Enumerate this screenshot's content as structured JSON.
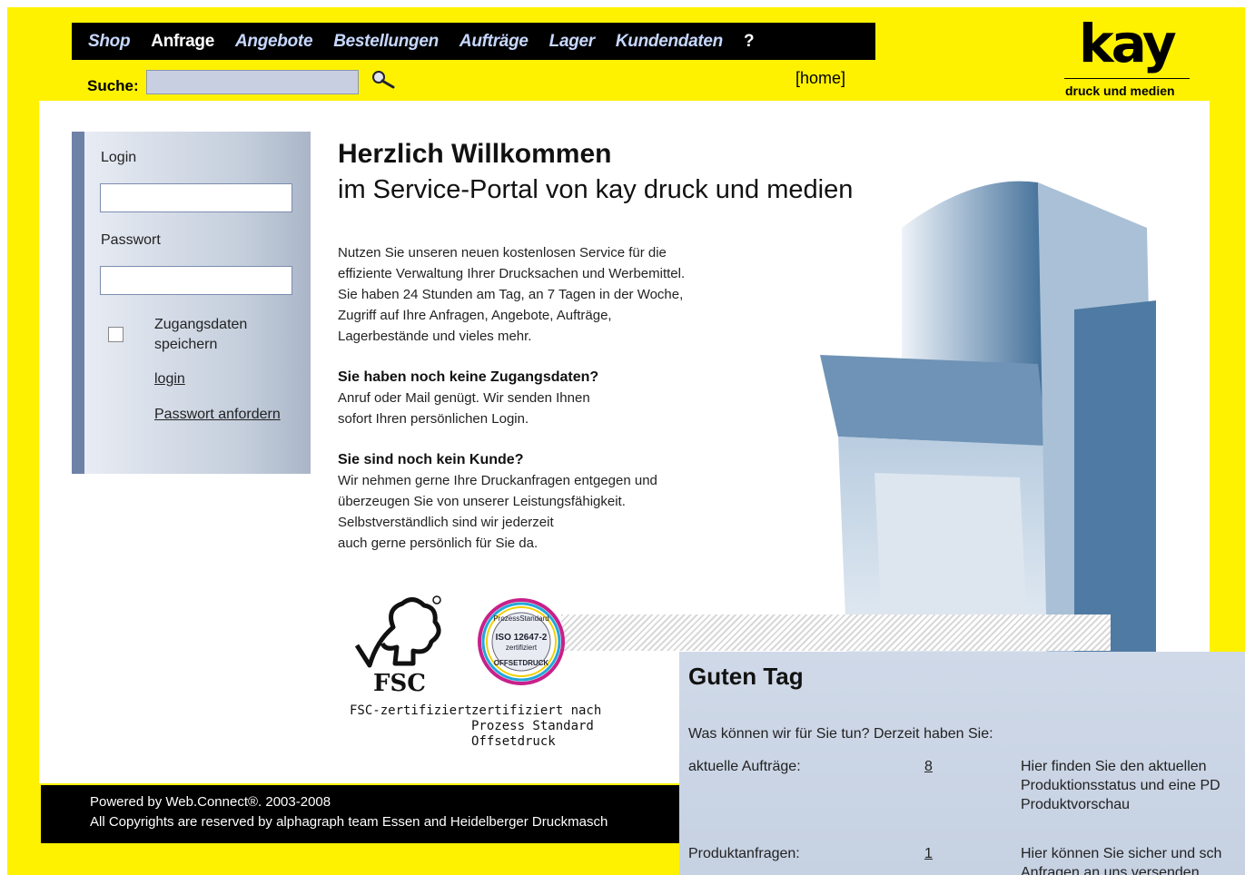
{
  "nav": {
    "items": [
      {
        "label": "Shop",
        "active": false
      },
      {
        "label": "Anfrage",
        "active": true
      },
      {
        "label": "Angebote",
        "active": false
      },
      {
        "label": "Bestellungen",
        "active": false
      },
      {
        "label": "Aufträge",
        "active": false
      },
      {
        "label": "Lager",
        "active": false
      },
      {
        "label": "Kundendaten",
        "active": false
      },
      {
        "label": "?",
        "active": false
      }
    ]
  },
  "search": {
    "label": "Suche:",
    "value": ""
  },
  "home_link": "[home]",
  "logo": {
    "name": "kay",
    "subtitle": "druck und medien"
  },
  "login": {
    "login_label": "Login",
    "login_value": "",
    "password_label": "Passwort",
    "password_value": "",
    "remember_label_1": "Zugangsdaten",
    "remember_label_2": "speichern",
    "remember_checked": false,
    "login_link": "login",
    "request_password_link": "Passwort anfordern"
  },
  "welcome": {
    "title": "Herzlich Willkommen",
    "subtitle": "im Service-Portal von kay druck und medien",
    "intro": [
      "Nutzen Sie unseren neuen kostenlosen Service für die",
      "effiziente Verwaltung Ihrer Drucksachen und Werbemittel.",
      "Sie haben 24 Stunden am Tag, an 7 Tagen in der Woche,",
      "Zugriff auf Ihre Anfragen, Angebote, Aufträge,",
      "Lagerbestände und vieles mehr."
    ],
    "no_access_heading": "Sie haben noch keine Zugangsdaten?",
    "no_access_text": [
      "Anruf oder Mail genügt. Wir senden Ihnen",
      "sofort Ihren persönlichen Login."
    ],
    "no_customer_heading": "Sie sind noch kein Kunde?",
    "no_customer_text": [
      "Wir nehmen gerne Ihre Druckanfragen entgegen und",
      "überzeugen Sie von unserer Leistungsfähigkeit.",
      "Selbstverständlich sind wir jederzeit",
      "auch gerne persönlich für Sie da."
    ]
  },
  "certs": {
    "fsc_logo_text": "FSC",
    "fsc_caption": "FSC-zertifiziert",
    "iso_badge_text": [
      "ProzessStandard",
      "ISO 12647-2",
      "zertifiziert",
      "OFFSETDRUCK"
    ],
    "iso_caption": [
      "zertifiziert nach",
      "Prozess Standard",
      "Offsetdruck"
    ]
  },
  "footer": {
    "line1": "Powered by Web.Connect®. 2003-2008",
    "line2": "All Copyrights are reserved by alphagraph team Essen and Heidelberger Druckmasch"
  },
  "popup": {
    "title": "Guten Tag",
    "question": "Was können wir für Sie tun? Derzeit haben Sie:",
    "rows": [
      {
        "label": "aktuelle Aufträge:",
        "count": "8",
        "desc": [
          "Hier finden Sie den aktuellen",
          "Produktionsstatus und eine PD",
          "Produktvorschau"
        ]
      },
      {
        "label": "Produktanfragen:",
        "count": "1",
        "desc": [
          "Hier können Sie sicher und sch",
          "Anfragen an uns versenden"
        ]
      }
    ]
  },
  "colors": {
    "background": "#fff200",
    "nav_bg": "#000000",
    "nav_text": "#c7d8ff",
    "panel_accent": "#6e82a8",
    "popup_bg": "#cfd9e8"
  }
}
